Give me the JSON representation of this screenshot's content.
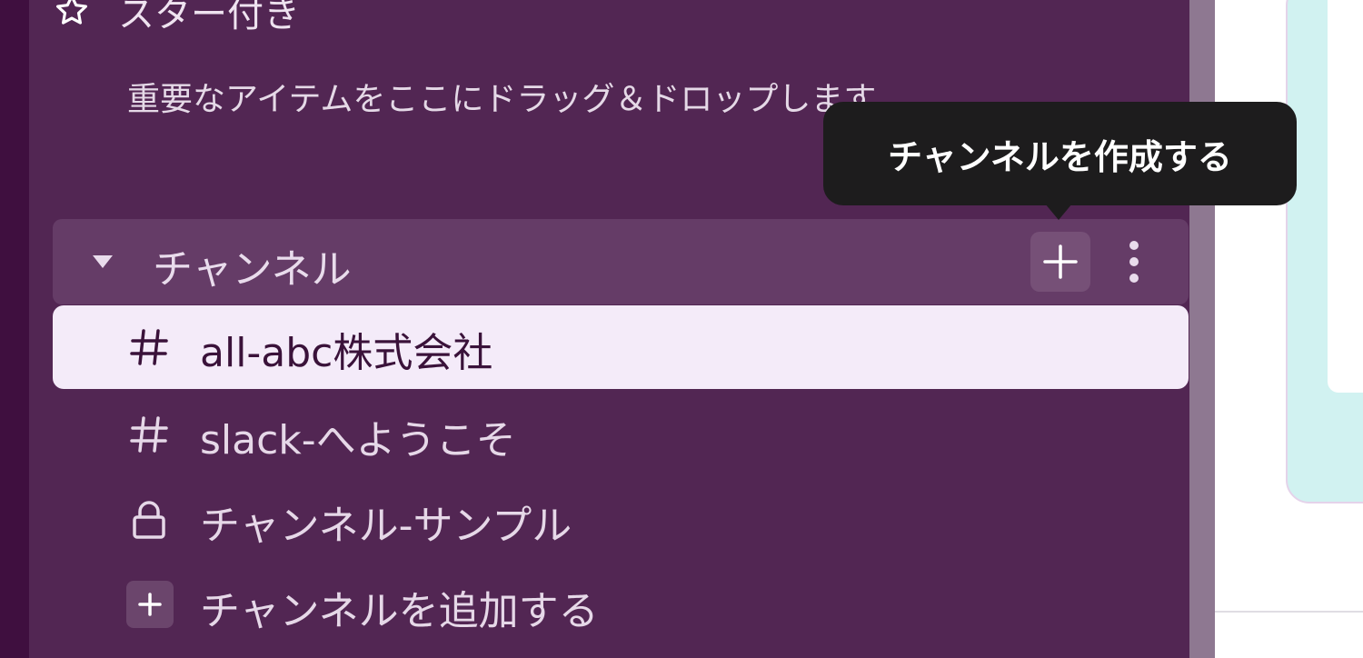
{
  "starred": {
    "title": "スター付き",
    "hint": "重要なアイテムをここにドラッグ＆ドロップします"
  },
  "channels_section": {
    "title": "チャンネル",
    "tooltip": "チャンネルを作成する",
    "channels": [
      {
        "label": "all-abc株式会社",
        "icon": "hash-icon",
        "active": true
      },
      {
        "label": "slack-へようこそ",
        "icon": "hash-icon",
        "active": false
      },
      {
        "label": "チャンネル-サンプル",
        "icon": "lock-icon",
        "active": false
      }
    ],
    "add_channel_label": "チャンネルを追加する"
  },
  "colors": {
    "sidebar_bg": "#522653",
    "active_item_bg": "#f4ebf9",
    "tooltip_bg": "#1d1c1d"
  }
}
